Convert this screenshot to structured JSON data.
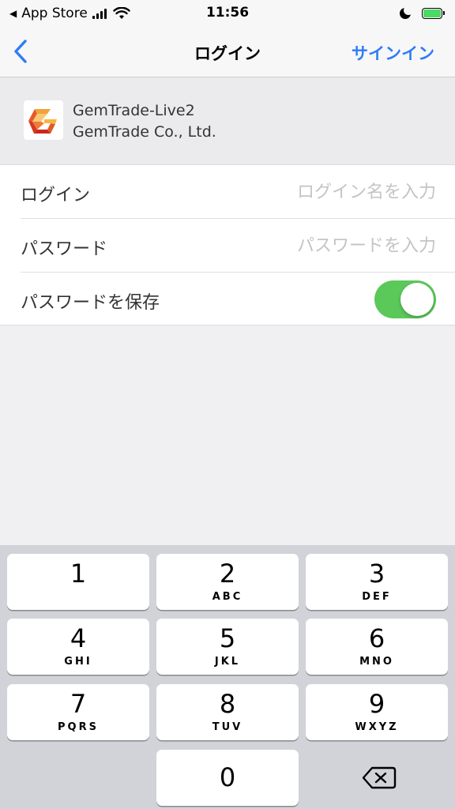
{
  "status_bar": {
    "back_app": "App Store",
    "time": "11:56",
    "battery_charging": true,
    "do_not_disturb": true
  },
  "nav": {
    "title": "ログイン",
    "action": "サインイン",
    "accent_color": "#2f7cf6"
  },
  "server": {
    "name": "GemTrade-Live2",
    "company": "GemTrade Co., Ltd."
  },
  "form": {
    "login_label": "ログイン",
    "login_placeholder": "ログイン名を入力",
    "login_value": "",
    "password_label": "パスワード",
    "password_placeholder": "パスワードを入力",
    "password_value": "",
    "save_password_label": "パスワードを保存",
    "save_password_on": true,
    "toggle_color": "#5bc85a"
  },
  "keypad": {
    "keys": [
      {
        "digit": "1",
        "letters": ""
      },
      {
        "digit": "2",
        "letters": "ABC"
      },
      {
        "digit": "3",
        "letters": "DEF"
      },
      {
        "digit": "4",
        "letters": "GHI"
      },
      {
        "digit": "5",
        "letters": "JKL"
      },
      {
        "digit": "6",
        "letters": "MNO"
      },
      {
        "digit": "7",
        "letters": "PQRS"
      },
      {
        "digit": "8",
        "letters": "TUV"
      },
      {
        "digit": "9",
        "letters": "WXYZ"
      },
      {
        "digit": "0",
        "letters": ""
      }
    ],
    "delete_icon": "delete-backspace-icon"
  }
}
